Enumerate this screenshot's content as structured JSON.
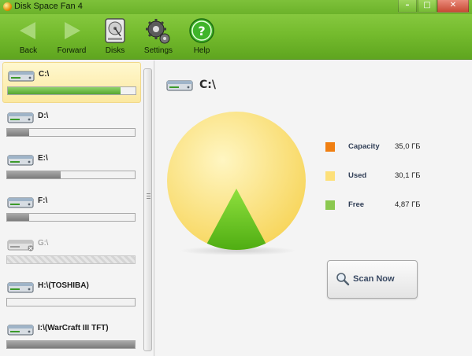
{
  "window": {
    "title": "Disk Space Fan 4",
    "controls": [
      "–",
      "□",
      "✕"
    ]
  },
  "toolbar": {
    "items": [
      {
        "label": "Back",
        "icon": "back-arrow-icon"
      },
      {
        "label": "Forward",
        "icon": "forward-arrow-icon"
      },
      {
        "label": "Disks",
        "icon": "hard-disk-icon"
      },
      {
        "label": "Settings",
        "icon": "gears-icon"
      },
      {
        "label": "Help",
        "icon": "help-icon"
      }
    ]
  },
  "drives": [
    {
      "name": "C:\\",
      "used_fraction": 0.88,
      "color": "green",
      "selected": true,
      "available": true
    },
    {
      "name": "D:\\",
      "used_fraction": 0.17,
      "color": "gray",
      "selected": false,
      "available": true
    },
    {
      "name": "E:\\",
      "used_fraction": 0.42,
      "color": "gray",
      "selected": false,
      "available": true
    },
    {
      "name": "F:\\",
      "used_fraction": 0.17,
      "color": "gray",
      "selected": false,
      "available": true
    },
    {
      "name": "G:\\",
      "used_fraction": 0,
      "color": "gray",
      "selected": false,
      "available": false
    },
    {
      "name": "H:\\(TOSHIBA)",
      "used_fraction": 0,
      "color": "gray",
      "selected": false,
      "available": true
    },
    {
      "name": "I:\\(WarCraft III TFT)",
      "used_fraction": 1.0,
      "color": "gray",
      "selected": false,
      "available": true
    }
  ],
  "main": {
    "drive_title": "C:\\",
    "legend": [
      {
        "label": "Capacity",
        "value": "35,0 ГБ",
        "color": "#f07f12"
      },
      {
        "label": "Used",
        "value": "30,1 ГБ",
        "color": "#fde07a"
      },
      {
        "label": "Free",
        "value": "4,87 ГБ",
        "color": "#8bc850"
      }
    ],
    "scan_button": "Scan Now"
  },
  "chart_data": {
    "type": "pie",
    "categories": [
      "Used",
      "Free"
    ],
    "values": [
      30.1,
      4.87
    ],
    "colors": [
      "#fde07a",
      "#6cc41f"
    ],
    "title": ""
  }
}
